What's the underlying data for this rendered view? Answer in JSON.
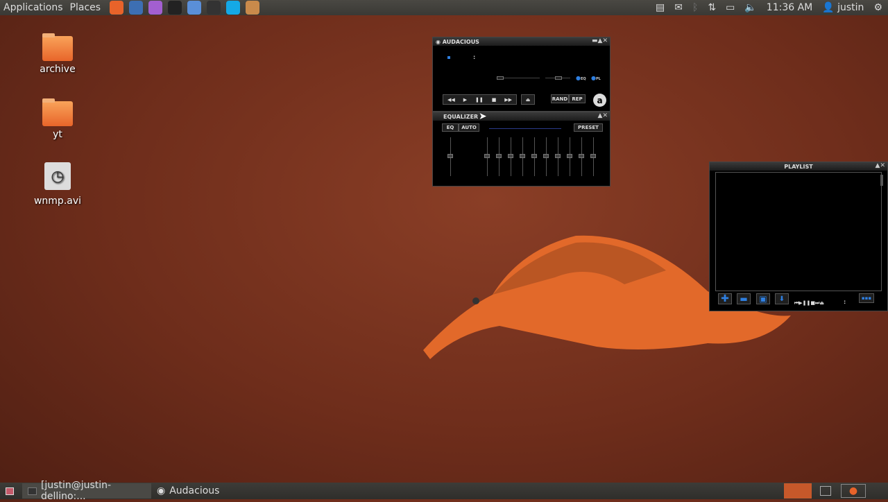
{
  "topbar": {
    "applications": "Applications",
    "places": "Places",
    "launchers": [
      {
        "icon": "firefox-icon",
        "color": "#e8632a"
      },
      {
        "icon": "thunderbird-icon",
        "color": "#3d6fb3"
      },
      {
        "icon": "settings-icon",
        "color": "#a35fd0"
      },
      {
        "icon": "terminal-icon",
        "color": "#222"
      },
      {
        "icon": "chromium-icon",
        "color": "#5a8fd8"
      },
      {
        "icon": "system-monitor-icon",
        "color": "#333"
      },
      {
        "icon": "skype-icon",
        "color": "#14a9e6"
      },
      {
        "icon": "archive-installer-icon",
        "color": "#c98a4b"
      }
    ],
    "time": "11:36 AM",
    "user": "justin"
  },
  "desktop": {
    "icons": [
      {
        "label": "archive",
        "type": "folder"
      },
      {
        "label": "yt",
        "type": "folder"
      },
      {
        "label": "wnmp.avi",
        "type": "video-file"
      }
    ]
  },
  "audacious": {
    "title": "AUDACIOUS",
    "time_sep": ":",
    "toggles": [
      "EQ",
      "PL"
    ],
    "rand": "RAND",
    "rep": "REP",
    "logo": "a"
  },
  "equalizer": {
    "title": "EQUALIZER",
    "eq": "EQ",
    "auto": "AUTO",
    "preset": "PRESET",
    "bands": 10
  },
  "playlist": {
    "title": "PLAYLIST",
    "time_sep": ":"
  },
  "taskbar": {
    "tasks": [
      {
        "label": "[justin@justin-dellino:...",
        "icon": "terminal-icon"
      },
      {
        "label": "Audacious",
        "icon": "audacious-icon"
      }
    ]
  },
  "colors": {
    "accent": "#2f7fe0",
    "panel": "#3c3b37"
  }
}
